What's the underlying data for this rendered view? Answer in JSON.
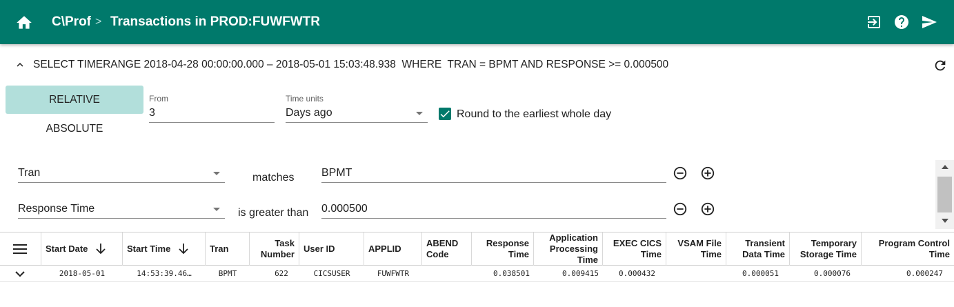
{
  "header": {
    "root": "C\\Prof",
    "separator": ">",
    "title": "Transactions in PROD:FUWFWTR",
    "icons": [
      "home-icon",
      "exit-icon",
      "help-icon",
      "send-icon"
    ],
    "bg_color": "#00796b"
  },
  "query": {
    "text": "SELECT TIMERANGE 2018-04-28 00:00:00.000 – 2018-05-01 15:03:48.938  WHERE  TRAN = BPMT AND RESPONSE >= 0.000500"
  },
  "timerange": {
    "relative_label": "RELATIVE",
    "absolute_label": "ABSOLUTE",
    "selected_mode": "RELATIVE",
    "from_label": "From",
    "from_value": "3",
    "units_label": "Time units",
    "units_value": "Days ago",
    "round_label": "Round to the earliest whole day",
    "round_checked": true
  },
  "conditions": [
    {
      "field": "Tran",
      "operator": "matches",
      "value": "BPMT"
    },
    {
      "field": "Response Time",
      "operator": "is greater than",
      "value": "0.000500"
    }
  ],
  "table": {
    "columns": [
      {
        "label": "Start Date",
        "sorted": "desc"
      },
      {
        "label": "Start Time",
        "sorted": "desc"
      },
      {
        "label": "Tran"
      },
      {
        "label": "Task Number"
      },
      {
        "label": "User ID"
      },
      {
        "label": "APPLID"
      },
      {
        "label": "ABEND Code"
      },
      {
        "label": "Response Time"
      },
      {
        "label": "Application Processing Time"
      },
      {
        "label": "EXEC CICS Time"
      },
      {
        "label": "VSAM File Time"
      },
      {
        "label": "Transient Data Time"
      },
      {
        "label": "Temporary Storage Time"
      },
      {
        "label": "Program Control Time"
      }
    ],
    "rows": [
      [
        "2018-05-01",
        "14:53:39.46…",
        "BPMT",
        "622",
        "CICSUSER",
        "FUWFWTR",
        "",
        "0.038501",
        "0.009415",
        "0.000432",
        "",
        "0.000051",
        "0.000076",
        "0.000247"
      ]
    ]
  }
}
